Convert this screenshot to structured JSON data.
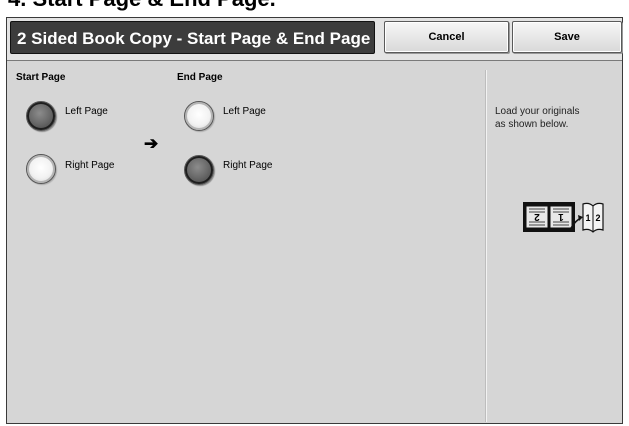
{
  "caption": "4. Start Page & End Page.",
  "header": {
    "title": "2 Sided Book Copy - Start Page & End Page",
    "cancel_label": "Cancel",
    "save_label": "Save"
  },
  "start_page": {
    "label": "Start Page",
    "options": [
      {
        "label": "Left Page",
        "selected": true
      },
      {
        "label": "Right Page",
        "selected": false
      }
    ]
  },
  "end_page": {
    "label": "End Page",
    "options": [
      {
        "label": "Left Page",
        "selected": false
      },
      {
        "label": "Right Page",
        "selected": true
      }
    ]
  },
  "transition_icon": "right-arrow-icon",
  "info": {
    "line1": "Load your originals",
    "line2": "as shown below."
  },
  "book_image": {
    "icon": "book-orientation-icon",
    "left_page_number": "2",
    "right_page_number": "1",
    "open_book_left": "1",
    "open_book_right": "2"
  }
}
